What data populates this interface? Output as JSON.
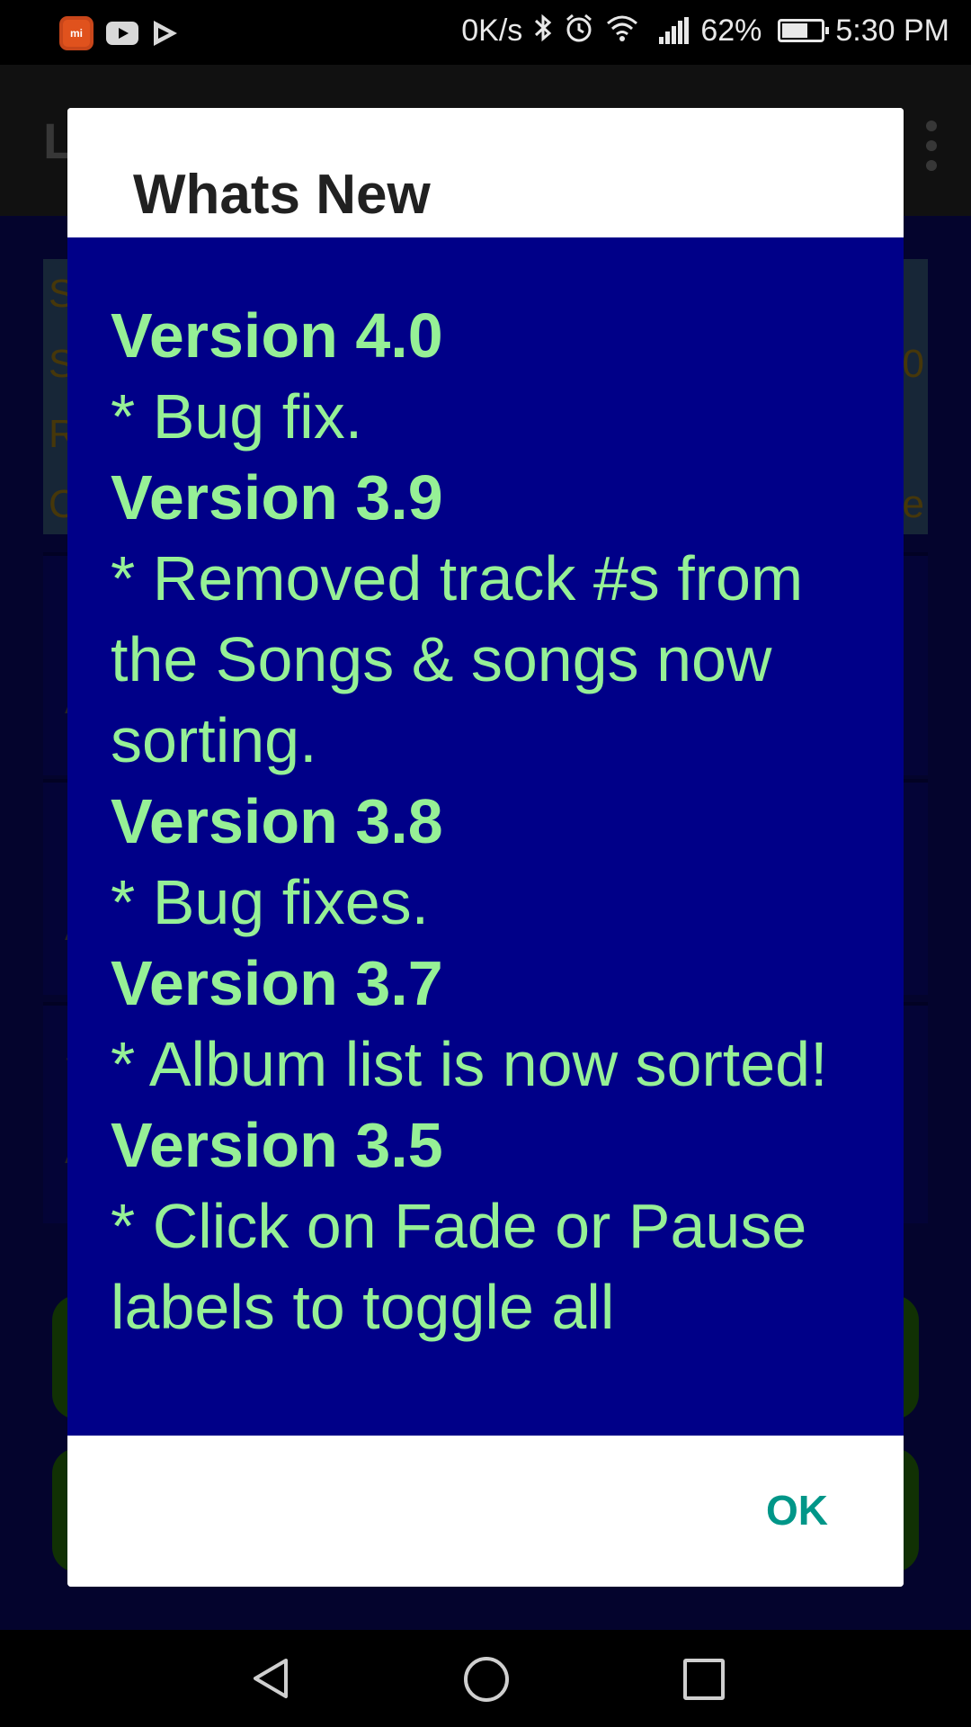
{
  "status_bar": {
    "network_speed": "0K/s",
    "battery_percent": "62%",
    "battery_level": 0.62,
    "time": "5:30 PM",
    "icons": [
      "mi-app-icon",
      "youtube-icon",
      "play-store-icon",
      "bluetooth-icon",
      "alarm-icon",
      "wifi-icon",
      "signal-icon",
      "battery-icon"
    ]
  },
  "background_app": {
    "toolbar_title": "L",
    "info_lines": [
      "S",
      "S",
      "R",
      "C"
    ],
    "info_right": [
      "0",
      "e"
    ],
    "row_labels": [
      "I",
      "A",
      "I",
      "A",
      "S",
      "A"
    ]
  },
  "dialog": {
    "title": "Whats New",
    "ok_label": "OK",
    "changelog": [
      {
        "version": "Version 4.0",
        "note": "* Bug fix."
      },
      {
        "version": "Version 3.9",
        "note": "* Removed track #s from the Songs & songs now sorting."
      },
      {
        "version": "Version 3.8",
        "note": "* Bug fixes."
      },
      {
        "version": "Version 3.7",
        "note": "* Album list is now sorted!"
      },
      {
        "version": "Version 3.5",
        "note": "* Click on Fade or Pause labels to toggle all"
      }
    ]
  },
  "colors": {
    "dialog_body_bg": "#000088",
    "changelog_text": "#96f096",
    "ok_button": "#009688"
  }
}
